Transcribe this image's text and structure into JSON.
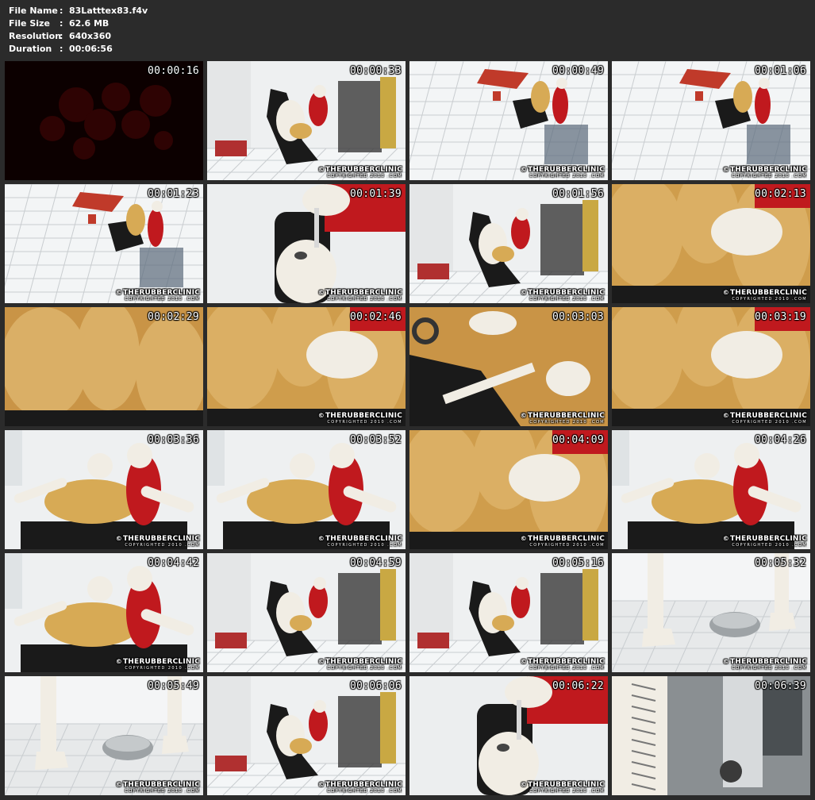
{
  "info": {
    "file_name_label": "File Name",
    "file_name": "83Latttex83.f4v",
    "file_size_label": "File Size",
    "file_size": "62.6 MB",
    "resolution_label": "Resolution",
    "resolution": "640x360",
    "duration_label": "Duration",
    "duration": "00:06:56",
    "separator": ":"
  },
  "watermark": {
    "symbol": "©",
    "brand": "THERUBBERCLINIC",
    "sub": "COPYRIGHTED 2010 .COM"
  },
  "colors": {
    "background": "#2b2b2b",
    "text": "#ffffff",
    "latex_red": "#c0191e",
    "latex_white": "#f1ede4",
    "latex_yellow": "#d7aa55",
    "chair_black": "#1a1a1a",
    "tile": "#f2f4f5"
  },
  "thumbnails": [
    {
      "time": "00:00:16",
      "scene": "dark-red-blur",
      "watermark": false
    },
    {
      "time": "00:00:33",
      "scene": "chair-wide",
      "watermark": true
    },
    {
      "time": "00:00:49",
      "scene": "overhead-room",
      "watermark": true
    },
    {
      "time": "00:01:06",
      "scene": "overhead-room",
      "watermark": true
    },
    {
      "time": "00:01:23",
      "scene": "overhead-room",
      "watermark": true
    },
    {
      "time": "00:01:39",
      "scene": "hood-closeup",
      "watermark": true
    },
    {
      "time": "00:01:56",
      "scene": "chair-wide",
      "watermark": true
    },
    {
      "time": "00:02:13",
      "scene": "glove-closeup",
      "watermark": true
    },
    {
      "time": "00:02:29",
      "scene": "yellow-latex-closeup",
      "watermark": false
    },
    {
      "time": "00:02:46",
      "scene": "glove-closeup",
      "watermark": true
    },
    {
      "time": "00:03:03",
      "scene": "strap-closeup",
      "watermark": true
    },
    {
      "time": "00:03:19",
      "scene": "glove-closeup",
      "watermark": true
    },
    {
      "time": "00:03:36",
      "scene": "chair-medium",
      "watermark": true
    },
    {
      "time": "00:03:52",
      "scene": "chair-medium",
      "watermark": true
    },
    {
      "time": "00:04:09",
      "scene": "glove-closeup",
      "watermark": true
    },
    {
      "time": "00:04:26",
      "scene": "chair-medium",
      "watermark": true
    },
    {
      "time": "00:04:42",
      "scene": "chair-medium",
      "watermark": true
    },
    {
      "time": "00:04:59",
      "scene": "chair-wide",
      "watermark": true
    },
    {
      "time": "00:05:16",
      "scene": "chair-wide",
      "watermark": true
    },
    {
      "time": "00:05:32",
      "scene": "boots-floor",
      "watermark": true
    },
    {
      "time": "00:05:49",
      "scene": "boots-floor",
      "watermark": true
    },
    {
      "time": "00:06:06",
      "scene": "chair-wide",
      "watermark": true
    },
    {
      "time": "00:06:22",
      "scene": "hood-closeup",
      "watermark": true
    },
    {
      "time": "00:06:39",
      "scene": "boot-lace-closeup",
      "watermark": false
    }
  ]
}
